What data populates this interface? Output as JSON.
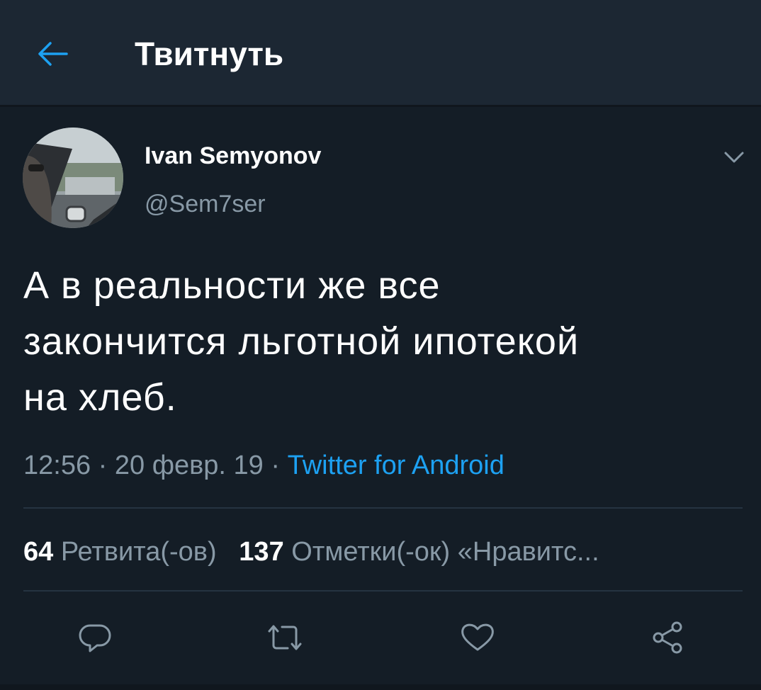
{
  "header": {
    "title": "Твитнуть",
    "back_icon": "arrow-left-icon"
  },
  "tweet": {
    "author": {
      "display_name": "Ivan Semyonov",
      "handle": "@Sem7ser"
    },
    "text_lines": [
      "А в реальности же все",
      "закончится льготной ипотекой",
      "на хлеб."
    ],
    "time": "12:56",
    "separator": "·",
    "date": "20 февр. 19",
    "source": "Twitter for Android",
    "stats": {
      "retweets_count": "64",
      "retweets_label": "Ретвита(-ов)",
      "likes_count": "137",
      "likes_label": "Отметки(-ок) «Нравитс..."
    }
  },
  "actions": {
    "reply_icon": "reply-icon",
    "retweet_icon": "retweet-icon",
    "like_icon": "heart-icon",
    "share_icon": "share-icon"
  },
  "colors": {
    "background": "#141d26",
    "header_bg": "#1c2733",
    "accent": "#1da1f2",
    "secondary_text": "#8899a6",
    "divider": "#253341"
  }
}
